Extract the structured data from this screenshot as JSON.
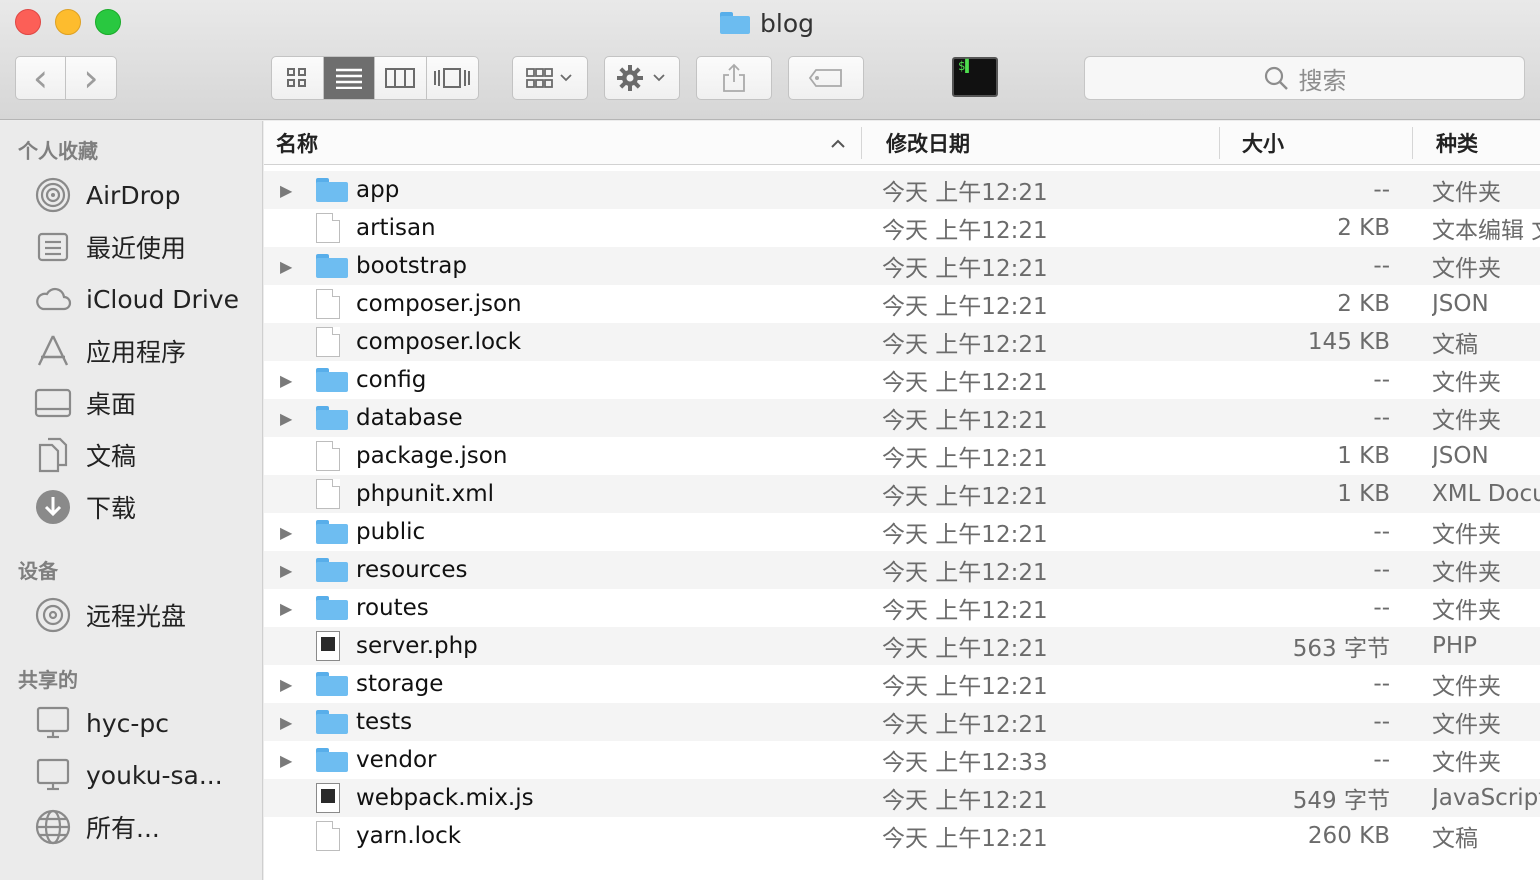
{
  "window": {
    "title": "blog"
  },
  "toolbar": {
    "back_glyph": "‹",
    "forward_glyph": "›",
    "search_placeholder": "搜索",
    "terminal_label": "$▌",
    "view_modes": [
      "icon",
      "list",
      "column",
      "coverflow"
    ],
    "active_view": "list"
  },
  "sidebar": {
    "favorites_title": "个人收藏",
    "favorites": [
      {
        "label": "AirDrop",
        "icon": "airdrop-icon"
      },
      {
        "label": "最近使用",
        "icon": "recents-icon"
      },
      {
        "label": "iCloud Drive",
        "icon": "icloud-icon"
      },
      {
        "label": "应用程序",
        "icon": "applications-icon"
      },
      {
        "label": "桌面",
        "icon": "desktop-icon"
      },
      {
        "label": "文稿",
        "icon": "documents-icon"
      },
      {
        "label": "下载",
        "icon": "downloads-icon"
      }
    ],
    "devices_title": "设备",
    "devices": [
      {
        "label": "远程光盘",
        "icon": "disc-icon"
      }
    ],
    "shared_title": "共享的",
    "shared": [
      {
        "label": "hyc-pc",
        "icon": "computer-icon"
      },
      {
        "label": "youku-sa...",
        "icon": "computer-icon"
      },
      {
        "label": "所有...",
        "icon": "network-icon"
      }
    ]
  },
  "columns": {
    "name": "名称",
    "date": "修改日期",
    "size": "大小",
    "kind": "种类"
  },
  "files": [
    {
      "name": "app",
      "type": "folder",
      "date": "今天 上午12:21",
      "size": "--",
      "kind": "文件夹"
    },
    {
      "name": "artisan",
      "type": "doc",
      "date": "今天 上午12:21",
      "size": "2 KB",
      "kind": "文本编辑 文稿"
    },
    {
      "name": "bootstrap",
      "type": "folder",
      "date": "今天 上午12:21",
      "size": "--",
      "kind": "文件夹"
    },
    {
      "name": "composer.json",
      "type": "doc",
      "date": "今天 上午12:21",
      "size": "2 KB",
      "kind": "JSON"
    },
    {
      "name": "composer.lock",
      "type": "doc",
      "date": "今天 上午12:21",
      "size": "145 KB",
      "kind": "文稿"
    },
    {
      "name": "config",
      "type": "folder",
      "date": "今天 上午12:21",
      "size": "--",
      "kind": "文件夹"
    },
    {
      "name": "database",
      "type": "folder",
      "date": "今天 上午12:21",
      "size": "--",
      "kind": "文件夹"
    },
    {
      "name": "package.json",
      "type": "doc",
      "date": "今天 上午12:21",
      "size": "1 KB",
      "kind": "JSON"
    },
    {
      "name": "phpunit.xml",
      "type": "doc",
      "date": "今天 上午12:21",
      "size": "1 KB",
      "kind": "XML Document"
    },
    {
      "name": "public",
      "type": "folder",
      "date": "今天 上午12:21",
      "size": "--",
      "kind": "文件夹"
    },
    {
      "name": "resources",
      "type": "folder",
      "date": "今天 上午12:21",
      "size": "--",
      "kind": "文件夹"
    },
    {
      "name": "routes",
      "type": "folder",
      "date": "今天 上午12:21",
      "size": "--",
      "kind": "文件夹"
    },
    {
      "name": "server.php",
      "type": "code",
      "date": "今天 上午12:21",
      "size": "563 字节",
      "kind": "PHP"
    },
    {
      "name": "storage",
      "type": "folder",
      "date": "今天 上午12:21",
      "size": "--",
      "kind": "文件夹"
    },
    {
      "name": "tests",
      "type": "folder",
      "date": "今天 上午12:21",
      "size": "--",
      "kind": "文件夹"
    },
    {
      "name": "vendor",
      "type": "folder",
      "date": "今天 上午12:33",
      "size": "--",
      "kind": "文件夹"
    },
    {
      "name": "webpack.mix.js",
      "type": "code",
      "date": "今天 上午12:21",
      "size": "549 字节",
      "kind": "JavaScript"
    },
    {
      "name": "yarn.lock",
      "type": "doc",
      "date": "今天 上午12:21",
      "size": "260 KB",
      "kind": "文稿"
    }
  ]
}
